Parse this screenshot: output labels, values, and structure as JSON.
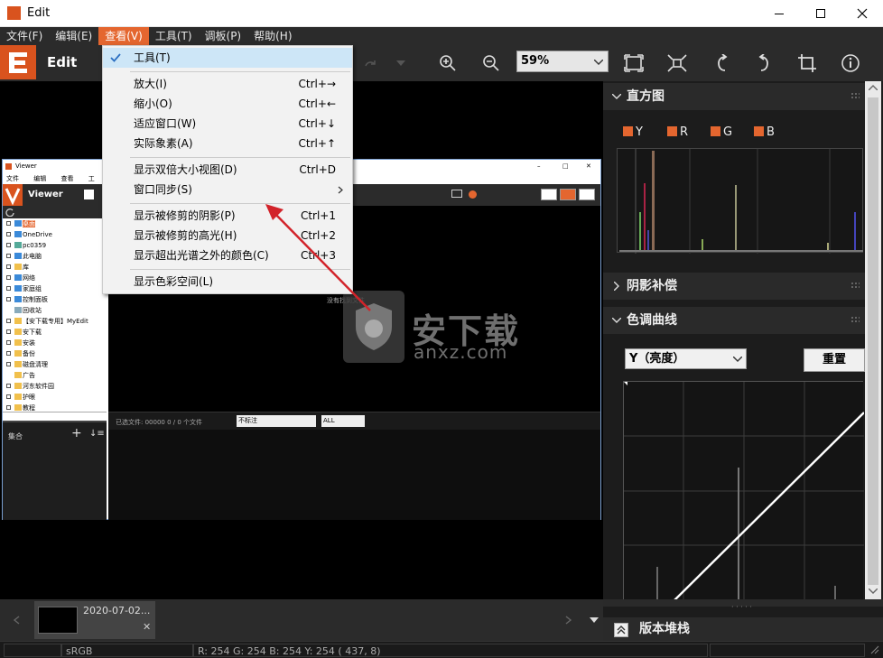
{
  "window": {
    "title": "Edit",
    "icon": "edit-app-icon"
  },
  "menubar": {
    "items": [
      "文件(F)",
      "编辑(E)",
      "查看(V)",
      "工具(T)",
      "调板(P)",
      "帮助(H)"
    ],
    "active_index": 2
  },
  "toolbar": {
    "app_name": "Edit",
    "zoom_value": "59%"
  },
  "view_menu": {
    "tools": "工具(T)",
    "zoom_in": "放大(I)",
    "zoom_in_sc": "Ctrl+→",
    "zoom_out": "缩小(O)",
    "zoom_out_sc": "Ctrl+←",
    "fit_window": "适应窗口(W)",
    "fit_window_sc": "Ctrl+↓",
    "actual_pixels": "实际象素(A)",
    "actual_pixels_sc": "Ctrl+↑",
    "double_view": "显示双倍大小视图(D)",
    "double_view_sc": "Ctrl+D",
    "window_sync": "窗口同步(S)",
    "show_clipped_shadows": "显示被修剪的阴影(P)",
    "show_clipped_shadows_sc": "Ctrl+1",
    "show_clipped_highlights": "显示被修剪的高光(H)",
    "show_clipped_highlights_sc": "Ctrl+2",
    "show_out_of_gamut": "显示超出光谱之外的颜色(C)",
    "show_out_of_gamut_sc": "Ctrl+3",
    "show_color_space": "显示色彩空间(L)"
  },
  "right_panel": {
    "histogram_title": "直方图",
    "channels": [
      "Y",
      "R",
      "G",
      "B"
    ],
    "shadow_title": "阴影补偿",
    "tone_curve_title": "色调曲线",
    "channel_select": "Y（亮度）",
    "reset_button": "重置",
    "version_stack": "版本堆栈"
  },
  "viewer": {
    "title": "Viewer",
    "menu": [
      "文件",
      "编辑",
      "查看",
      "工"
    ],
    "app_name": "Viewer",
    "tree": [
      "桌面",
      "OneDrive",
      "pc0359",
      "此电脑",
      "库",
      "网络",
      "家庭组",
      "控制面板",
      "回收站",
      "【安下载专用】MyEdit",
      "安下载",
      "安装",
      "备份",
      "磁盘清理",
      "广告",
      "河东软件园",
      "护眼",
      "教程"
    ],
    "collection": "集合",
    "status_files": "已选文件: 00000   0 / 0 个文件",
    "filter": "不标注",
    "all": "ALL",
    "center_text": "没有找到文件"
  },
  "watermark": {
    "brand": "安下载",
    "url": "anxz.com"
  },
  "filmstrip": {
    "item_label": "2020-07-02..."
  },
  "statusbar": {
    "colorspace": "sRGB",
    "values": "R: 254  G: 254  B: 254  Y: 254    ( 437,     8)"
  }
}
